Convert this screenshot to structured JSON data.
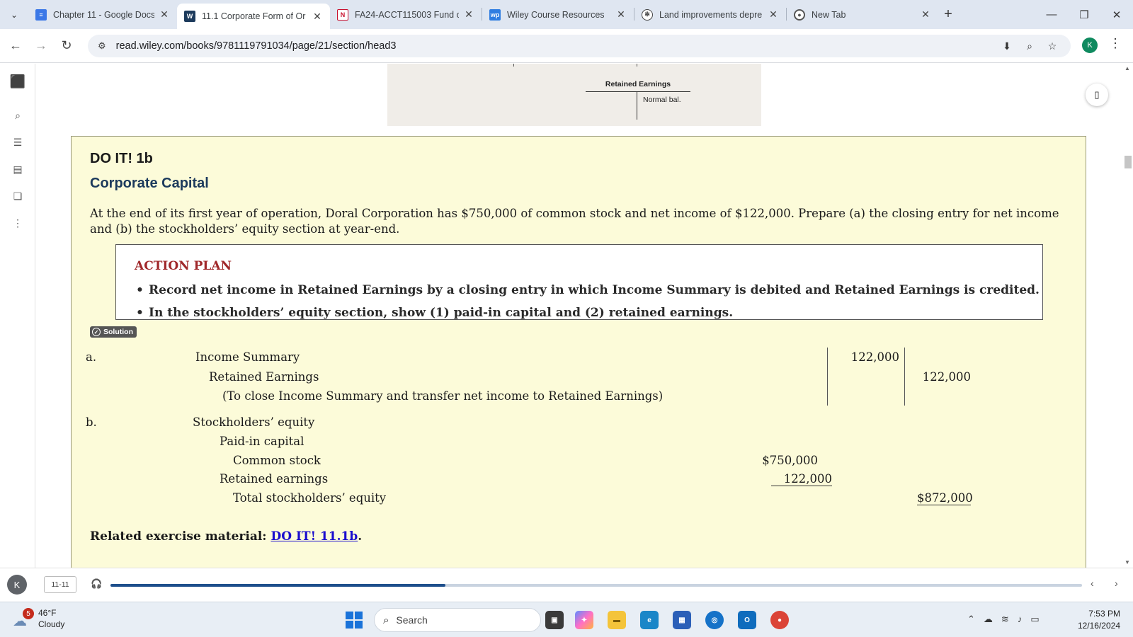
{
  "browser": {
    "tabs": [
      {
        "title": "Chapter 11 - Google Docs",
        "favicon": "google-docs-icon",
        "color": "#3b78e7",
        "active": false
      },
      {
        "title": "11.1 Corporate Form of Or",
        "favicon": "wiley-icon",
        "color": "#1c3a5c",
        "active": true
      },
      {
        "title": "FA24-ACCT115003 Fund of",
        "favicon": "nu-icon",
        "color": "#c8102e",
        "active": false
      },
      {
        "title": "Wiley Course Resources",
        "favicon": "wp-icon",
        "color": "#2f7de1",
        "active": false
      },
      {
        "title": "Land improvements depre",
        "favicon": "openai-icon",
        "color": "#444444",
        "active": false
      },
      {
        "title": "New Tab",
        "favicon": "chrome-icon",
        "color": "#555555",
        "active": false
      }
    ],
    "url": "read.wiley.com/books/9781119791034/page/21/section/head3",
    "profile_initial": "K"
  },
  "figure": {
    "account_title": "Retained Earnings",
    "normal_balance": "Normal bal."
  },
  "doit": {
    "heading": "DO IT! 1b",
    "subheading": "Corporate Capital",
    "prompt": "At the end of its first year of operation, Doral Corporation has $750,000 of common stock and net income of $122,000. Prepare (a) the closing entry for net income and (b) the stockholders’ equity section at year-end.",
    "action_plan_title": "ACTION PLAN",
    "action_plan_items": [
      "Record net income in Retained Earnings by a closing entry in which Income Summary is debited and Retained Earnings is credited.",
      "In the stockholders’ equity section, show (1) paid-in capital and (2) retained earnings."
    ],
    "solution_label": "Solution",
    "part_a": {
      "label": "a.",
      "debit_account": "Income Summary",
      "credit_account": "Retained Earnings",
      "explanation": "(To close Income Summary and transfer net income to Retained Earnings)",
      "debit_amount": "122,000",
      "credit_amount": "122,000"
    },
    "part_b": {
      "label": "b.",
      "section": "Stockholders’ equity",
      "paid_in": "Paid-in capital",
      "common_stock": "Common stock",
      "common_stock_amount": "$750,000",
      "retained": "Retained earnings",
      "retained_amount": "122,000",
      "total": "Total stockholders’ equity",
      "total_amount": "$872,000"
    },
    "related_label": "Related exercise material:",
    "related_link": "DO IT! 11.1b",
    "related_period": "."
  },
  "reader": {
    "user_initial": "K",
    "page": "11-11",
    "progress_fraction": 0.345
  },
  "taskbar": {
    "weather_badge": "5",
    "temperature": "46°F",
    "condition": "Cloudy",
    "search_placeholder": "Search",
    "time": "7:53 PM",
    "date": "12/16/2024"
  }
}
